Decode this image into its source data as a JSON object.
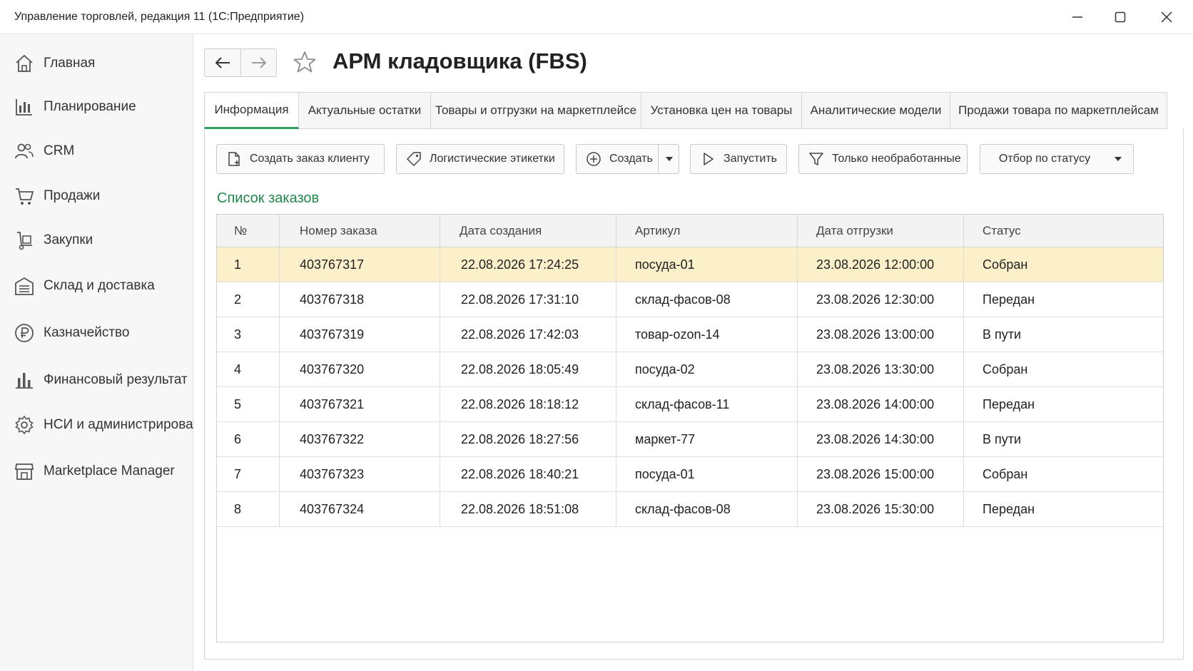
{
  "window": {
    "title": "Управление торговлей, редакция 11  (1С:Предприятие)"
  },
  "sidebar": {
    "items": [
      {
        "label": "Главная",
        "icon": "home-icon"
      },
      {
        "label": "Планирование",
        "icon": "planning-chart-icon"
      },
      {
        "label": "CRM",
        "icon": "users-icon"
      },
      {
        "label": "Продажи",
        "icon": "cart-icon"
      },
      {
        "label": "Закупки",
        "icon": "hand-truck-icon"
      },
      {
        "label": "Склад и доставка",
        "icon": "warehouse-icon"
      },
      {
        "label": "Казначейство",
        "icon": "ruble-icon"
      },
      {
        "label": "Финансовый результат",
        "icon": "bar-chart-icon"
      },
      {
        "label": "НСИ и администрирование",
        "icon": "gear-icon"
      },
      {
        "label": "Marketplace Manager",
        "icon": "store-icon"
      }
    ]
  },
  "page": {
    "title": "АРМ кладовщика (FBS)"
  },
  "tabs": [
    {
      "label": "Информация",
      "active": true
    },
    {
      "label": "Актуальные остатки",
      "active": false
    },
    {
      "label": "Товары и отгрузки на маркетплейсе",
      "active": false
    },
    {
      "label": "Установка цен на товары",
      "active": false
    },
    {
      "label": "Аналитические модели",
      "active": false
    },
    {
      "label": "Продажи товара по маркетплейсам",
      "active": false
    }
  ],
  "toolbar": {
    "create_order": "Создать заказ клиенту",
    "logistic_labels": "Логистические этикетки",
    "create": "Создать",
    "run": "Запустить",
    "only_unprocessed": "Только необработанные",
    "status_filter": "Отбор по статусу"
  },
  "orders": {
    "title": "Список заказов",
    "columns": [
      "№",
      "Номер заказа",
      "Дата создания",
      "Артикул",
      "Дата отгрузки",
      "Статус"
    ],
    "rows": [
      [
        "1",
        "403767317",
        "22.08.2026 17:24:25",
        "посуда-01",
        "23.08.2026 12:00:00",
        "Собран"
      ],
      [
        "2",
        "403767318",
        "22.08.2026 17:31:10",
        "склад-фасов-08",
        "23.08.2026 12:30:00",
        "Передан"
      ],
      [
        "3",
        "403767319",
        "22.08.2026 17:42:03",
        "товар-ozon-14",
        "23.08.2026 13:00:00",
        "В пути"
      ],
      [
        "4",
        "403767320",
        "22.08.2026 18:05:49",
        "посуда-02",
        "23.08.2026 13:30:00",
        "Собран"
      ],
      [
        "5",
        "403767321",
        "22.08.2026 18:18:12",
        "склад-фасов-11",
        "23.08.2026 14:00:00",
        "Передан"
      ],
      [
        "6",
        "403767322",
        "22.08.2026 18:27:56",
        "маркет-77",
        "23.08.2026 14:30:00",
        "В пути"
      ],
      [
        "7",
        "403767323",
        "22.08.2026 18:40:21",
        "посуда-01",
        "23.08.2026 15:00:00",
        "Собран"
      ],
      [
        "8",
        "403767324",
        "22.08.2026 18:51:08",
        "склад-фасов-08",
        "23.08.2026 15:30:00",
        "Передан"
      ]
    ],
    "selected_row": 0
  },
  "colors": {
    "accent_green": "#1f8a4c",
    "selected_row": "#fbf0c9"
  }
}
